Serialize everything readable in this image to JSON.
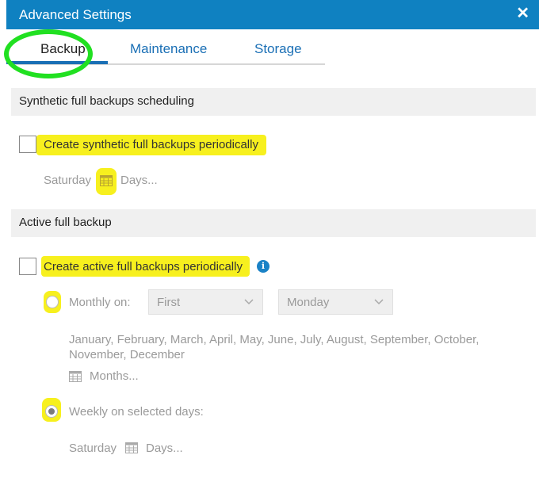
{
  "window": {
    "title": "Advanced Settings",
    "close_glyph": "✕"
  },
  "tabs": [
    {
      "label": "Backup",
      "active": true
    },
    {
      "label": "Maintenance",
      "active": false
    },
    {
      "label": "Storage",
      "active": false
    }
  ],
  "synthetic": {
    "header": "Synthetic full backups scheduling",
    "checkbox_label": "Create synthetic full backups periodically",
    "checked": false,
    "day": "Saturday",
    "days_link": "Days..."
  },
  "active": {
    "header": "Active full backup",
    "checkbox_label": "Create active full backups periodically",
    "checked": false,
    "info_glyph": "i",
    "monthly_label": "Monthly on:",
    "monthly_ordinal": "First",
    "monthly_day": "Monday",
    "months_text": "January, February, March, April, May, June, July, August, September, October, November, December",
    "months_link": "Months...",
    "weekly_label": "Weekly on selected days:",
    "weekly_selected": true,
    "weekly_day": "Saturday",
    "weekly_days_link": "Days..."
  },
  "colors": {
    "titlebar": "#0f81c1",
    "tab_accent": "#1a6fb5",
    "highlight": "#f7f01e",
    "annotation_circle": "#21e021"
  },
  "icons": {
    "close": "close-icon",
    "calendar": "calendar-icon",
    "info": "info-icon",
    "chevron": "chevron-down-icon"
  }
}
